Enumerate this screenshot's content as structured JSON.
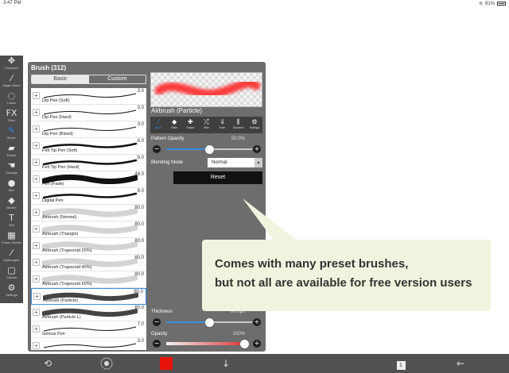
{
  "status_bar": {
    "time": "3:47 PM",
    "battery": "91%"
  },
  "tools": [
    {
      "label": "Transform",
      "icon": "move-icon",
      "glyph": "✥"
    },
    {
      "label": "Magic Wand",
      "icon": "magic-wand-icon",
      "glyph": "⁄"
    },
    {
      "label": "Lasso",
      "icon": "lasso-icon",
      "glyph": "◌"
    },
    {
      "label": "Filter",
      "icon": "filter-icon",
      "glyph": "FX"
    },
    {
      "label": "Brush",
      "icon": "brush-icon",
      "glyph": "✎"
    },
    {
      "label": "Eraser",
      "icon": "eraser-icon",
      "glyph": "▰"
    },
    {
      "label": "Smudge",
      "icon": "smudge-icon",
      "glyph": "☚"
    },
    {
      "label": "Blur",
      "icon": "blur-icon",
      "glyph": "●"
    },
    {
      "label": "Bucket",
      "icon": "bucket-icon",
      "glyph": "◆"
    },
    {
      "label": "Text",
      "icon": "text-icon",
      "glyph": "T"
    },
    {
      "label": "Frame Divider",
      "icon": "frame-divider-icon",
      "glyph": "▦"
    },
    {
      "label": "Eyedropper",
      "icon": "eyedropper-icon",
      "glyph": "⁄"
    },
    {
      "label": "Canvas",
      "icon": "canvas-icon",
      "glyph": "▢"
    },
    {
      "label": "Settings",
      "icon": "gear-icon",
      "glyph": "⚙"
    }
  ],
  "brush_panel": {
    "title": "Brush (312)",
    "tabs": {
      "basic": "Basic",
      "custom": "Custom"
    },
    "brushes": [
      {
        "name": "Dip Pen (Soft)",
        "size": "3.0",
        "stroke": "thin"
      },
      {
        "name": "Dip Pen (Hard)",
        "size": "3.0",
        "stroke": "thin"
      },
      {
        "name": "Dip Pen (Bleed)",
        "size": "3.0",
        "stroke": "thin"
      },
      {
        "name": "Felt Tip Pen (Soft)",
        "size": "8.0",
        "stroke": "medium"
      },
      {
        "name": "Felt Tip Pen (Hard)",
        "size": "8.0",
        "stroke": "medium"
      },
      {
        "name": "Pen (Fade)",
        "size": "48.0",
        "stroke": "thick"
      },
      {
        "name": "Digital Pen",
        "size": "8.0",
        "stroke": "medium"
      },
      {
        "name": "Airbrush (Normal)",
        "size": "80.0",
        "stroke": "airbrush"
      },
      {
        "name": "Airbrush (Triangle)",
        "size": "80.0",
        "stroke": "airbrush"
      },
      {
        "name": "Airbrush (Trapezoid 20%)",
        "size": "80.0",
        "stroke": "airbrush"
      },
      {
        "name": "Airbrush (Trapezoid 40%)",
        "size": "80.0",
        "stroke": "airbrush"
      },
      {
        "name": "Airbrush (Trapezoid 60%)",
        "size": "80.0",
        "stroke": "airbrush"
      },
      {
        "name": "Airbrush (Particle)",
        "size": "80.0",
        "stroke": "particle",
        "selected": true
      },
      {
        "name": "Airbrush (Particle L)",
        "size": "80.0",
        "stroke": "particle"
      },
      {
        "name": "Genius Pen",
        "size": "7.0",
        "stroke": "thin"
      },
      {
        "name": "",
        "size": "3.0",
        "stroke": "thin"
      }
    ],
    "preview_name": "Airbrush (Particle)",
    "property_tabs": [
      {
        "label": "Basic",
        "icon": "pen-icon",
        "glyph": "⁄"
      },
      {
        "label": "Fade",
        "icon": "fade-icon",
        "glyph": "◆"
      },
      {
        "label": "Shape",
        "icon": "shape-icon",
        "glyph": "✚"
      },
      {
        "label": "Jitter",
        "icon": "jitter-icon",
        "glyph": "⤮"
      },
      {
        "label": "Note",
        "icon": "note-icon",
        "glyph": "⇓"
      },
      {
        "label": "Dynamic",
        "icon": "dynamic-icon",
        "glyph": "⫼"
      },
      {
        "label": "Settings",
        "icon": "gear-icon",
        "glyph": "⚙"
      }
    ],
    "pattern_opacity": {
      "label": "Pattern Opacity",
      "value": "50.0%",
      "level": 0.5
    },
    "blending_mode": {
      "label": "Blending Mode",
      "value": "Normal"
    },
    "reset_label": "Reset",
    "thickness": {
      "label": "Thickness",
      "value": "80.0px",
      "level": 0.5
    },
    "opacity": {
      "label": "Opacity",
      "value": "100%",
      "level": 1.0
    }
  },
  "callout": {
    "line1": "Comes with many preset brushes,",
    "line2": "but not all are available for free version users"
  },
  "colors": {
    "current_color": "#e8140c",
    "accent": "#3a8ee6",
    "callout_bg": "#f2f3de"
  },
  "bottom_bar": {
    "icons": [
      "quick-menu-icon",
      "brush-size-icon",
      "color-swatch",
      "down-arrow-icon",
      "layers-icon",
      "back-arrow-icon"
    ],
    "layer_count": "1"
  }
}
